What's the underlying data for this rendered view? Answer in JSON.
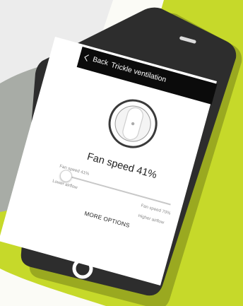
{
  "header": {
    "back_label": "Back",
    "title": "Trickle ventilation"
  },
  "main": {
    "fan_speed_text": "Fan speed 41%",
    "slider": {
      "value_percent": 41,
      "current_label": "Fan speed 41%",
      "lower_label": "Lower airflow",
      "max_label": "Fan speed 70%",
      "higher_label": "Higher airflow"
    },
    "more_options_label": "MORE OPTIONS"
  },
  "colors": {
    "background_lime": "#c6d92a",
    "phone_body": "#2d2d2d",
    "screen": "#ffffff",
    "topbar": "#0b0b0b"
  },
  "icons": {
    "back": "chevron-left-icon",
    "home": "home-button-icon",
    "dial": "fan-dial-icon"
  }
}
